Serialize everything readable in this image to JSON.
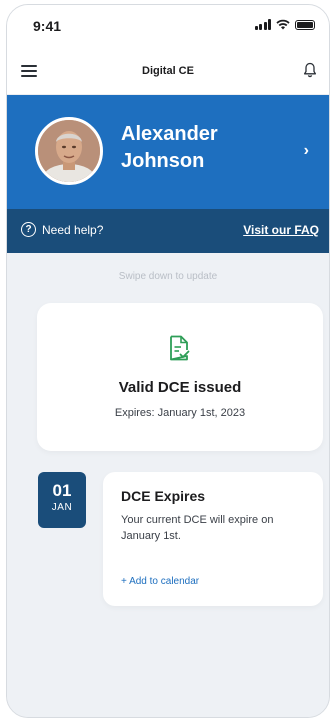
{
  "status_bar": {
    "time": "9:41"
  },
  "nav": {
    "title": "Digital CE"
  },
  "profile": {
    "name": "Alexander Johnson",
    "chevron": "›"
  },
  "help": {
    "text": "Need help?",
    "icon": "?",
    "faq_link": "Visit our FAQ"
  },
  "content": {
    "swipe_hint": "Swipe down to update",
    "dce_card": {
      "status": "Valid DCE issued",
      "expires": "Expires: January 1st, 2023"
    },
    "event": {
      "day": "01",
      "month": "JAN",
      "title": "DCE Expires",
      "description": "Your current DCE will expire on January 1st.",
      "add_calendar": "+ Add to calendar"
    }
  },
  "colors": {
    "primary_blue": "#1e6fbf",
    "dark_blue": "#1a4d7a",
    "success_green": "#2e9e57",
    "background": "#eef1f5"
  }
}
